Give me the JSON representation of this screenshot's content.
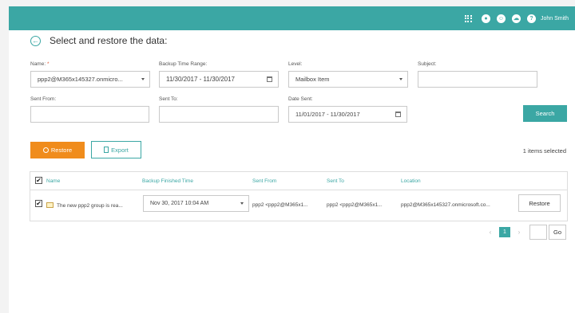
{
  "topbar": {
    "user_name": "John Smith",
    "icons": [
      "apps-grid-icon",
      "notification-icon",
      "smile-icon",
      "cloud-icon",
      "help-icon"
    ],
    "accent_color": "#3ba7a4"
  },
  "header": {
    "title": "Select and restore the data:"
  },
  "form": {
    "name": {
      "label": "Name:",
      "required_mark": "*",
      "value": "ppp2@M365x145327.onmicro..."
    },
    "backup_time_range": {
      "label": "Backup Time Range:",
      "value": "11/30/2017 - 11/30/2017"
    },
    "level": {
      "label": "Level:",
      "value": "Mailbox Item"
    },
    "subject": {
      "label": "Subject:",
      "value": ""
    },
    "sent_from": {
      "label": "Sent From:",
      "value": ""
    },
    "sent_to": {
      "label": "Sent To:",
      "value": ""
    },
    "date_sent": {
      "label": "Date Sent:",
      "value": "11/01/2017 - 11/30/2017"
    },
    "search_label": "Search"
  },
  "toolbar": {
    "restore_label": "Restore",
    "export_label": "Export",
    "selected_text": "1 items selected",
    "restore_color": "#f08c1c"
  },
  "table": {
    "headers": [
      "Name",
      "Backup Finished Time",
      "Sent From",
      "Sent To",
      "Location"
    ],
    "rows": [
      {
        "name": "The new ppp2 group is rea...",
        "backup_time": "Nov 30, 2017 10:04 AM",
        "sent_from": "ppp2 <ppp2@M365x1...",
        "sent_to": "ppp2 <ppp2@M365x1...",
        "location": "ppp2@M365x145327.onmicrosoft.co...",
        "restore_label": "Restore",
        "checked": true
      }
    ]
  },
  "pager": {
    "prev": "‹",
    "current": "1",
    "next": "›",
    "go_label": "Go"
  }
}
